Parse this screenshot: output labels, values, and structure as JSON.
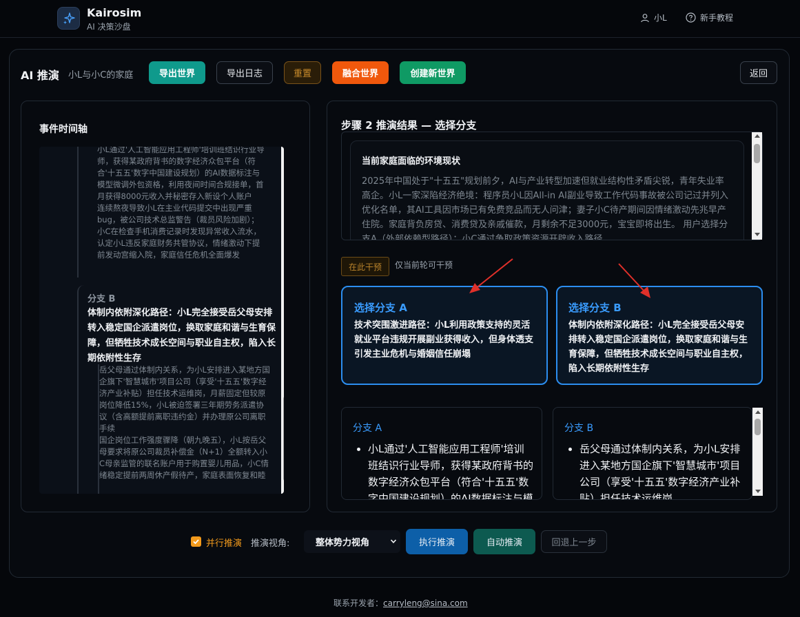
{
  "brand": {
    "title": "Kairosim",
    "subtitle": "AI 决策沙盘"
  },
  "topnav": {
    "user": "小L",
    "help": "新手教程"
  },
  "toolbar": {
    "title": "AI 推演",
    "world_name": "小L与小C的家庭",
    "export_world": "导出世界",
    "export_log": "导出日志",
    "reset": "重置",
    "merge_world": "融合世界",
    "create_world": "创建新世界",
    "back": "返回"
  },
  "timeline": {
    "title": "事件时间轴",
    "top_block": [
      "小L通过'人工智能应用工程师'培训班结识行业导师，获得某政府背书的数字经济众包平台（符合'十五五'数字中国建设规划）的AI数据标注与模型微调外包资格，利用夜间时间合规接单，首月获得8000元收入并秘密存入新设个人账户",
      "连续熬夜导致小L在主业代码提交中出现严重bug，被公司技术总监警告（裁员风险加剧）；小C在检查手机消费记录时发现异常收入流水，认定小L违反家庭财务共管协议，情绪激动下提前发动宫缩入院，家庭信任危机全面爆发"
    ],
    "branch_b_card": {
      "label": "分支 B",
      "headline": "体制内依附深化路径：小L完全接受岳父母安排转入稳定国企派遣岗位，换取家庭和谐与生育保障，但牺牲技术成长空间与职业自主权，陷入长期依附性生存",
      "body": [
        "岳父母通过体制内关系，为小L安排进入某地方国企旗下'智慧城市'项目公司（享受'十五五'数字经济产业补贴）担任技术运维岗，月薪固定但较原岗位降低15%，小L被迫签署三年期劳务派遣协议（含高额提前离职违约金）并办理原公司离职手续",
        "国企岗位工作强度骤降（朝九晚五），小L按岳父母要求将原公司裁员补偿金（N+1）全额转入小C母亲监管的联名账户用于购置婴儿用品，小C情绪稳定提前两周休产假待产，家庭表面恢复和睦"
      ]
    }
  },
  "result": {
    "step_title": "步骤 2 推演结果 — 选择分支",
    "env_title": "当前家庭面临的环境现状",
    "env_body": "2025年中国处于\"十五五\"规划前夕，AI与产业转型加速但就业结构性矛盾尖锐，青年失业率高企。小L一家深陷经济绝境：程序员小L因All-in AI副业导致工作代码事故被公司记过并列入优化名单，其AI工具因市场已有免费竞品而无人问津；妻子小C待产期间因情绪激动先兆早产住院。家庭背负房贷、消费贷及亲戚催款，月剩余不足3000元，宝宝即将出生。 用户选择分支A（外部依赖型路径）：小C通过争取政策资源开辟收入路径"
  },
  "intervene": {
    "tag": "在此干预",
    "note": "仅当前轮可干预"
  },
  "branches": [
    {
      "title": "选择分支 A",
      "desc": "技术突围激进路径：小L利用政策支持的灵活就业平台违规开展副业获得收入，但身体透支引发主业危机与婚姻信任崩塌"
    },
    {
      "title": "选择分支 B",
      "desc": "体制内依附深化路径：小L完全接受岳父母安排转入稳定国企派遣岗位，换取家庭和谐与生育保障，但牺牲技术成长空间与职业自主权，陷入长期依附性生存"
    }
  ],
  "details": [
    {
      "title": "分支 A",
      "item": "小L通过'人工智能应用工程师'培训班结识行业导师，获得某政府背书的数字经济众包平台（符合'十五五'数字中国建设规划）的AI数据标注与模型微调外包资格"
    },
    {
      "title": "分支 B",
      "item": "岳父母通过体制内关系，为小L安排进入某地方国企旗下'智慧城市'项目公司（享受'十五五'数字经济产业补贴）担任技术运维岗"
    }
  ],
  "controls": {
    "parallel_label": "并行推演",
    "parallel_checked": true,
    "view_label": "推演视角:",
    "view_value": "整体势力视角",
    "run": "执行推演",
    "auto": "自动推演",
    "undo": "回退上一步"
  },
  "footer": {
    "prefix": "联系开发者：",
    "email": "carryleng@sina.com"
  },
  "colors": {
    "accent_blue": "#2c8ef0",
    "teal": "#0f9a8c",
    "orange": "#f0580c",
    "green": "#0f9a64",
    "annotation_red": "#e0302a"
  }
}
